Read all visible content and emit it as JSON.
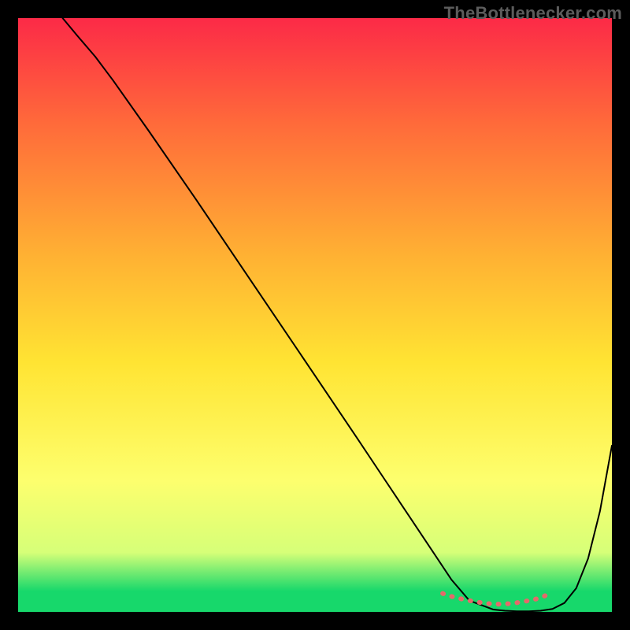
{
  "watermark": "TheBottlenecker.com",
  "chart_data": {
    "type": "line",
    "title": "",
    "xlabel": "",
    "ylabel": "",
    "xlim": [
      0,
      100
    ],
    "ylim": [
      0,
      100
    ],
    "series": [
      {
        "name": "curve",
        "stroke": "#000000",
        "stroke_width": 2,
        "x": [
          7.5,
          10,
          13,
          16,
          22,
          30,
          40,
          50,
          57,
          60,
          62,
          64,
          66,
          68,
          70,
          73,
          76,
          80,
          82,
          84,
          86,
          88,
          90,
          92,
          94,
          96,
          98,
          100
        ],
        "y": [
          100,
          97,
          93.5,
          89.5,
          81,
          69.4,
          54.6,
          39.8,
          29.4,
          24.9,
          21.9,
          18.9,
          15.9,
          12.9,
          9.9,
          5.4,
          1.9,
          0.4,
          0.2,
          0.1,
          0.1,
          0.2,
          0.5,
          1.5,
          4,
          9,
          17,
          28
        ]
      },
      {
        "name": "highlight-dots",
        "stroke": "#e46a6a",
        "stroke_width": 6,
        "dash": [
          1,
          11
        ],
        "x": [
          71.5,
          73,
          75,
          77,
          79,
          81,
          83,
          85,
          87,
          88.5,
          89.5
        ],
        "y": [
          3.1,
          2.6,
          2.1,
          1.7,
          1.4,
          1.3,
          1.4,
          1.7,
          2.1,
          2.6,
          3.1
        ]
      }
    ],
    "gradient": {
      "top_color": "#fc2a47",
      "mid_colors": [
        "#ff6b3a",
        "#ffb133",
        "#ffe433",
        "#fdff6e",
        "#d6ff78"
      ],
      "bottom_color": "#17d86b",
      "stops": [
        0,
        0.18,
        0.4,
        0.58,
        0.78,
        0.9,
        0.965,
        1.0
      ]
    }
  }
}
